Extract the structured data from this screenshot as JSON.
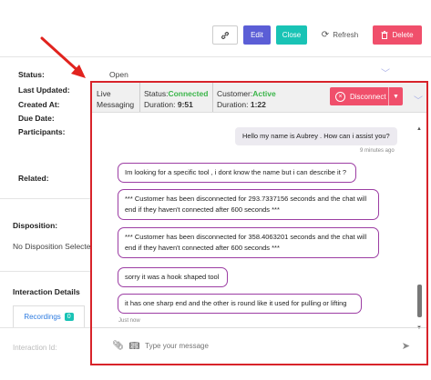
{
  "toolbar": {
    "link_icon": "link-icon",
    "edit_label": "Edit",
    "close_label": "Close",
    "refresh_label": "Refresh",
    "delete_label": "Delete"
  },
  "details": {
    "status_label": "Status:",
    "status_value": "Open",
    "last_updated_label": "Last Updated:",
    "created_at_label": "Created At:",
    "due_date_label": "Due Date:",
    "participants_label": "Participants:",
    "related_label": "Related:"
  },
  "disposition": {
    "title": "Disposition:",
    "value": "No Disposition Selected"
  },
  "interaction": {
    "title": "Interaction Details",
    "recordings_tab": "Recordings",
    "recordings_count": "0",
    "interaction_id_label": "Interaction Id:"
  },
  "chat": {
    "channel_line1": "Live",
    "channel_line2": "Messaging",
    "status_label": "Status:",
    "status_value": "Connected",
    "duration_label": "Duration:",
    "duration_value": "9:51",
    "customer_label": "Customer:",
    "customer_value": "Active",
    "customer_duration_label": "Duration:",
    "customer_duration_value": "1:22",
    "disconnect_label": "Disconnect",
    "messages": [
      {
        "from": "agent",
        "text": "Hello my name is Aubrey . How can i assist you?"
      },
      {
        "from": "customer",
        "text": "Im looking for a specific tool , i dont know the name but i can describe it ?"
      },
      {
        "from": "customer",
        "text": "*** Customer has been disconnected for 293.7337156 seconds and the chat will end if they haven't connected after 600 seconds ***"
      },
      {
        "from": "customer",
        "text": "*** Customer has been disconnected for 358.4063201 seconds and the chat will end if they haven't connected after 600 seconds ***"
      },
      {
        "from": "customer",
        "text": "sorry it was a hook shaped tool"
      },
      {
        "from": "customer",
        "text": "it has one sharp end and the other is round like it used for pulling or lifting"
      }
    ],
    "agent_timestamp": "9 minutes ago",
    "last_timestamp": "Just now",
    "input_placeholder": "Type your message"
  },
  "colors": {
    "accent_red": "#d8232a",
    "edit_blue": "#5b5ed6",
    "close_teal": "#19c3b5",
    "delete_pink": "#f04f6b",
    "connected_green": "#3bb54a",
    "customer_bubble_border": "#9c3da3"
  }
}
